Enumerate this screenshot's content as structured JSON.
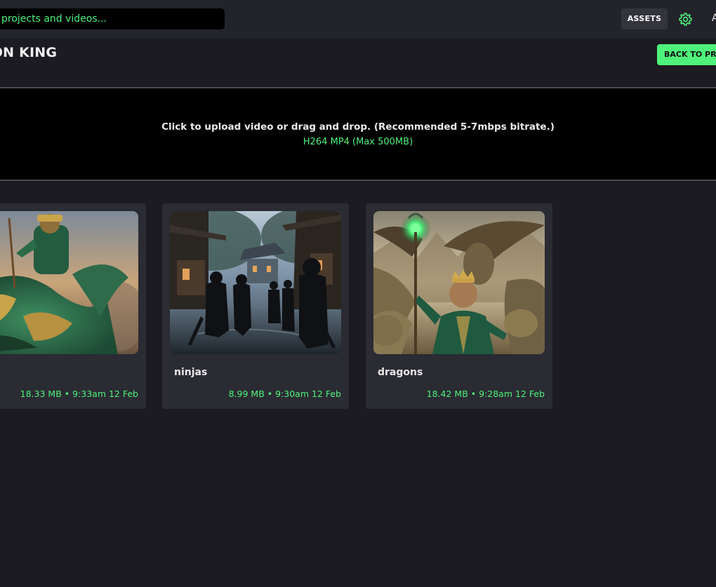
{
  "topbar": {
    "search_placeholder": "projects and videos...",
    "assets_label": "ASSETS",
    "cut_letter": "A"
  },
  "project": {
    "title": "GON KING",
    "back_label": "BACK TO PR"
  },
  "upload": {
    "instruction": "Click to upload video or drag and drop. (Recommended 5-7mbps bitrate.)",
    "format_hint": "H264 MP4 (Max 500MB)"
  },
  "videos": [
    {
      "name": "",
      "meta": "18.33 MB • 9:33am 12 Feb"
    },
    {
      "name": "ninjas",
      "meta": "8.99 MB • 9:30am 12 Feb"
    },
    {
      "name": "dragons",
      "meta": "18.42 MB • 9:28am 12 Feb"
    }
  ],
  "colors": {
    "accent": "#4ef27a",
    "background": "#1c1b21",
    "topbar": "#23242b",
    "card": "#2a2b33"
  },
  "icons": {
    "settings": "gear-icon"
  }
}
